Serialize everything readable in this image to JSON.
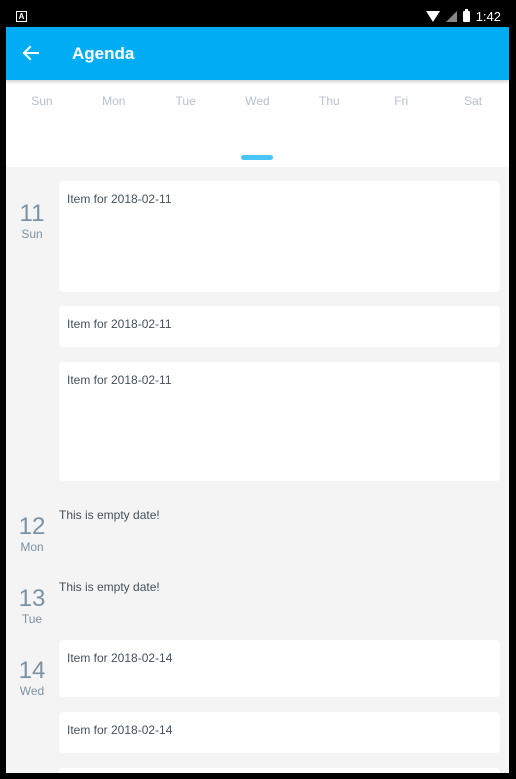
{
  "status_bar": {
    "time": "1:42",
    "app_icon_letter": "A",
    "icons": [
      "app-notification-icon",
      "wifi-icon",
      "signal-icon",
      "battery-icon"
    ]
  },
  "header": {
    "title": "Agenda",
    "back_icon": "arrow-left-icon",
    "background_color": "#00adf5"
  },
  "week": {
    "days": [
      "Sun",
      "Mon",
      "Tue",
      "Wed",
      "Thu",
      "Fri",
      "Sat"
    ],
    "knob_color": "#4ac4f7"
  },
  "agenda": {
    "days": [
      {
        "day": "11",
        "weekday": "Sun",
        "items": [
          "Item for 2018-02-11",
          "Item for 2018-02-11",
          "Item for 2018-02-11"
        ]
      },
      {
        "day": "12",
        "weekday": "Mon",
        "empty": "This is empty date!"
      },
      {
        "day": "13",
        "weekday": "Tue",
        "empty": "This is empty date!"
      },
      {
        "day": "14",
        "weekday": "Wed",
        "items": [
          "Item for 2018-02-14",
          "Item for 2018-02-14"
        ]
      }
    ]
  }
}
